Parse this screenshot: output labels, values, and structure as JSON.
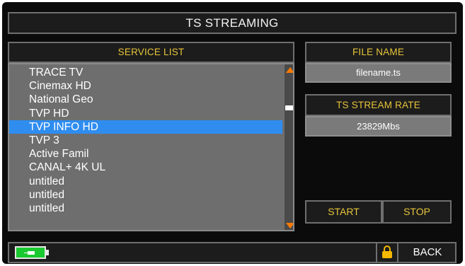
{
  "title": "TS STREAMING",
  "service_list": {
    "header": "SERVICE LIST",
    "items": [
      "TRACE TV",
      "Cinemax HD",
      "National Geo",
      "TVP HD",
      "TVP INFO HD",
      "TVP 3",
      "Active Famil",
      "CANAL+ 4K UL",
      "untitled",
      "untitled",
      "untitled"
    ],
    "selected_index": 4
  },
  "file": {
    "header": "FILE NAME",
    "value": "filename.ts"
  },
  "rate": {
    "header": "TS STREAM RATE",
    "value": "23829Mbs"
  },
  "buttons": {
    "start": "START",
    "stop": "STOP",
    "back": "BACK"
  },
  "colors": {
    "accent_yellow": "#e7c53a",
    "selection_blue": "#2f8df0",
    "scroll_orange": "#ff7a00",
    "battery_green": "#19c92f",
    "lock_yellow": "#f5b800"
  },
  "icons": {
    "battery": "battery-charging-icon",
    "lock": "lock-icon",
    "scroll_up": "arrow-up-icon",
    "scroll_down": "arrow-down-icon"
  }
}
